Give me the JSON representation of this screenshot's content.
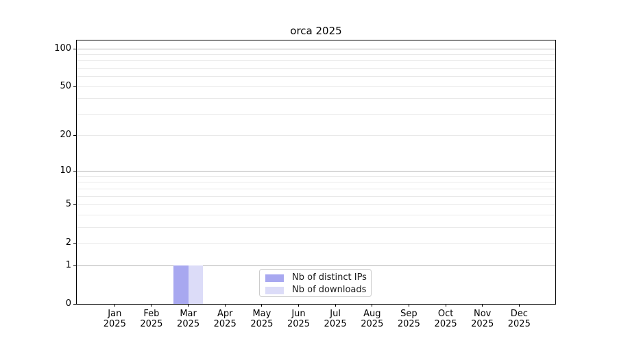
{
  "chart_data": {
    "type": "bar",
    "title": "orca 2025",
    "categories": [
      "Jan 2025",
      "Feb 2025",
      "Mar 2025",
      "Apr 2025",
      "May 2025",
      "Jun 2025",
      "Jul 2025",
      "Aug 2025",
      "Sep 2025",
      "Oct 2025",
      "Nov 2025",
      "Dec 2025"
    ],
    "x_tick_months": [
      "Jan",
      "Feb",
      "Mar",
      "Apr",
      "May",
      "Jun",
      "Jul",
      "Aug",
      "Sep",
      "Oct",
      "Nov",
      "Dec"
    ],
    "x_tick_year": "2025",
    "series": [
      {
        "name": "Nb of distinct IPs",
        "color": "#a8a8f0",
        "values": [
          0,
          0,
          1,
          0,
          0,
          0,
          0,
          0,
          0,
          0,
          0,
          0
        ]
      },
      {
        "name": "Nb of downloads",
        "color": "#dcdcf8",
        "values": [
          0,
          0,
          1,
          0,
          0,
          0,
          0,
          0,
          0,
          0,
          0,
          0
        ]
      }
    ],
    "xlabel": "",
    "ylabel": "",
    "yscale": "log1p",
    "ylim": [
      0,
      115
    ],
    "ytick_values": [
      0,
      1,
      2,
      5,
      10,
      20,
      50,
      100
    ],
    "grid": "on",
    "grid_major_at": [
      1,
      10,
      100
    ],
    "grid_minor_at": [
      2,
      3,
      4,
      5,
      6,
      7,
      8,
      9,
      20,
      30,
      40,
      50,
      60,
      70,
      80,
      90
    ],
    "legend_position": "bottom-center",
    "colors": {
      "axis": "#000000",
      "grid_major": "#b3b3b3",
      "grid_minor": "#e9e9e9",
      "background": "#ffffff"
    }
  }
}
